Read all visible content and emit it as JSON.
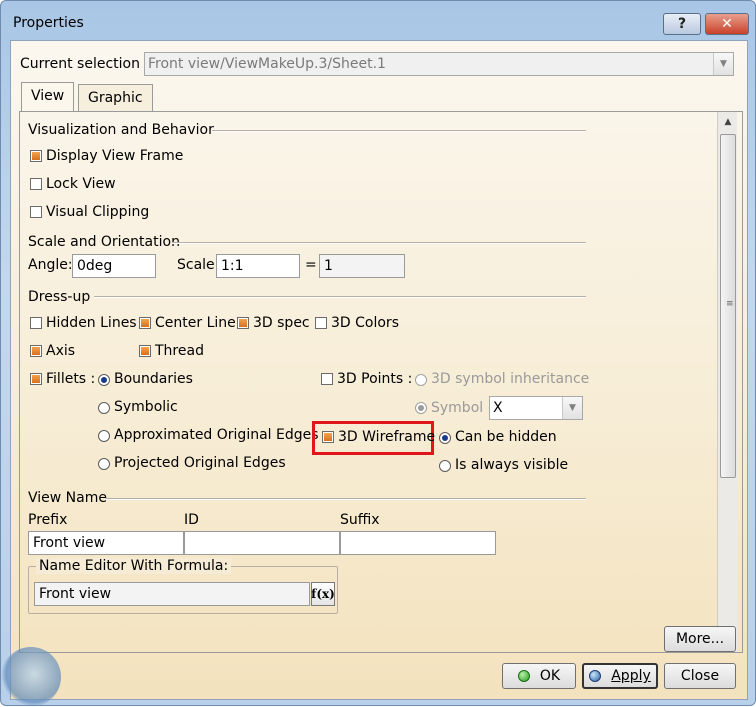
{
  "window": {
    "title": "Properties",
    "help_glyph": "?",
    "close_glyph": "✕"
  },
  "selection": {
    "label": "Current selection :",
    "value": "Front view/ViewMakeUp.3/Sheet.1"
  },
  "tabs": [
    {
      "label": "View",
      "active": true
    },
    {
      "label": "Graphic",
      "active": false
    }
  ],
  "visualization": {
    "title": "Visualization and Behavior",
    "items": [
      {
        "label": "Display View Frame",
        "checked": true
      },
      {
        "label": "Lock View",
        "checked": false
      },
      {
        "label": "Visual Clipping",
        "checked": false
      }
    ]
  },
  "scale": {
    "title": "Scale and Orientation",
    "angle_label": "Angle:",
    "angle_value": "0deg",
    "scale_label": "Scale:",
    "scale_value": "1:1",
    "equals": "=",
    "result_value": "1"
  },
  "dressup": {
    "title": "Dress-up",
    "hidden_lines": {
      "label": "Hidden Lines",
      "checked": false
    },
    "center_line": {
      "label": "Center Line",
      "checked": true
    },
    "spec_3d": {
      "label": "3D spec",
      "checked": true
    },
    "colors_3d": {
      "label": "3D Colors",
      "checked": false
    },
    "axis": {
      "label": "Axis",
      "checked": true
    },
    "thread": {
      "label": "Thread",
      "checked": true
    },
    "fillets": {
      "label": "Fillets :",
      "checked": true,
      "options": [
        {
          "label": "Boundaries",
          "selected": true
        },
        {
          "label": "Symbolic",
          "selected": false
        },
        {
          "label": "Approximated Original Edges",
          "selected": false
        },
        {
          "label": "Projected Original Edges",
          "selected": false
        }
      ]
    },
    "points_3d": {
      "label": "3D Points :",
      "checked": false,
      "inheritance_label": "3D symbol inheritance",
      "symbol_label": "Symbol",
      "symbol_value": "X"
    },
    "wireframe_3d": {
      "label": "3D Wireframe",
      "checked": true,
      "highlight_color": "#e0161a",
      "options": [
        {
          "label": "Can be hidden",
          "selected": true
        },
        {
          "label": "Is always visible",
          "selected": false
        }
      ]
    }
  },
  "view_name": {
    "title": "View Name",
    "prefix_label": "Prefix",
    "prefix_value": "Front view",
    "id_label": "ID",
    "id_value": "",
    "suffix_label": "Suffix",
    "suffix_value": "",
    "editor_label": "Name Editor With Formula:",
    "editor_value": "Front view",
    "fx_label": "f(x)"
  },
  "buttons": {
    "more": "More...",
    "ok": "OK",
    "apply": "Apply",
    "close": "Close"
  },
  "colors": {
    "checkbox_fill": "#e07a22",
    "radio_dot": "#1a3a8a",
    "ok_led": "#1f9a1a",
    "apply_led": "#2c5ea8"
  }
}
